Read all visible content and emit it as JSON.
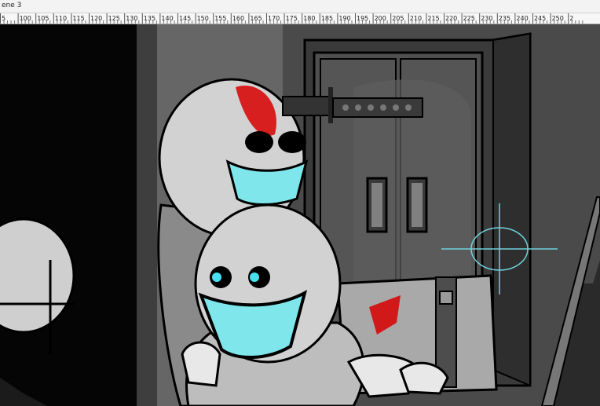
{
  "window": {
    "tab_title": "ene 3"
  },
  "ruler": {
    "unit": "frames",
    "labels": [
      "5",
      "100",
      "105",
      "110",
      "115",
      "120",
      "125",
      "130",
      "135",
      "140",
      "145",
      "150",
      "155",
      "160",
      "165",
      "170",
      "175",
      "180",
      "185",
      "190",
      "195",
      "200",
      "205",
      "210",
      "215",
      "220",
      "225",
      "230",
      "235",
      "240",
      "245",
      "250",
      "2"
    ]
  },
  "canvas": {
    "scene": "cartoon-frame",
    "colors": {
      "outline": "#000000",
      "head_fill": "#d2d2d2",
      "body_fill": "#bdbdbd",
      "teeth_fill": "#7fe6ec",
      "eye_glow": "#48e0ee",
      "blood": "#d80000",
      "crosshair": "#6fd2dc",
      "wall_dark": "#454545",
      "door_fill": "#4e4e4e"
    },
    "crosshair_visible": true
  }
}
